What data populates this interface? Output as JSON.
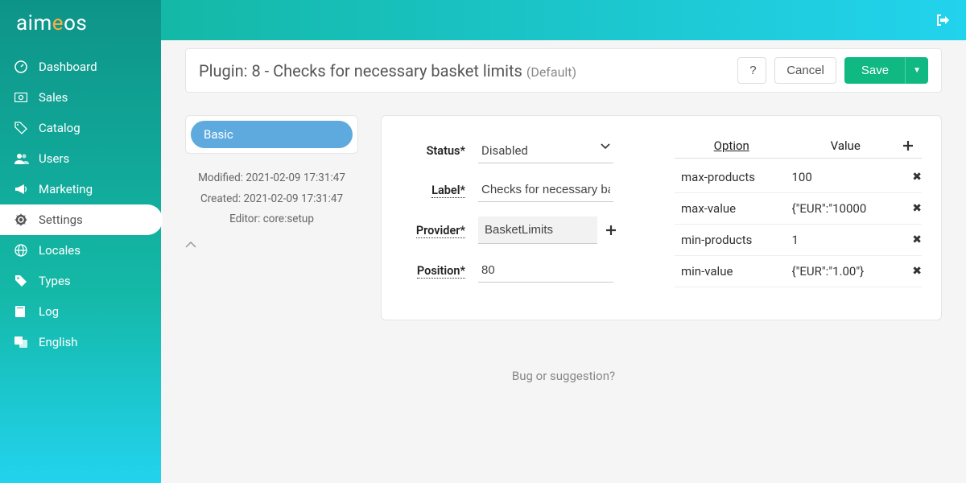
{
  "brand": {
    "pre": "aim",
    "accent": "e",
    "post": "os"
  },
  "sidebar": {
    "items": [
      {
        "icon": "dashboard",
        "label": "Dashboard"
      },
      {
        "icon": "money",
        "label": "Sales"
      },
      {
        "icon": "tags",
        "label": "Catalog"
      },
      {
        "icon": "users",
        "label": "Users"
      },
      {
        "icon": "bullhorn",
        "label": "Marketing"
      },
      {
        "icon": "cog",
        "label": "Settings"
      },
      {
        "icon": "globe",
        "label": "Locales"
      },
      {
        "icon": "tag",
        "label": "Types"
      },
      {
        "icon": "book",
        "label": "Log"
      },
      {
        "icon": "lang",
        "label": "English"
      }
    ]
  },
  "header": {
    "title": "Plugin: 8 - Checks for necessary basket limits",
    "suffix": "(Default)",
    "help": "?",
    "cancel": "Cancel",
    "save": "Save"
  },
  "tabs": {
    "basic": "Basic"
  },
  "meta": {
    "modified": "Modified: 2021-02-09 17:31:47",
    "created": "Created: 2021-02-09 17:31:47",
    "editor": "Editor: core:setup"
  },
  "form": {
    "status_label": "Status*",
    "status_value": "Disabled",
    "label_label": "Label*",
    "label_value": "Checks for necessary basket limits",
    "provider_label": "Provider*",
    "provider_value": "BasketLimits",
    "position_label": "Position*",
    "position_value": "80"
  },
  "options": {
    "col_option": "Option",
    "col_value": "Value",
    "rows": [
      {
        "option": "max-products",
        "value": "100"
      },
      {
        "option": "max-value",
        "value": "{\"EUR\":\"10000"
      },
      {
        "option": "min-products",
        "value": "1"
      },
      {
        "option": "min-value",
        "value": "{\"EUR\":\"1.00\"}"
      }
    ]
  },
  "footer": {
    "bug": "Bug or suggestion?"
  }
}
